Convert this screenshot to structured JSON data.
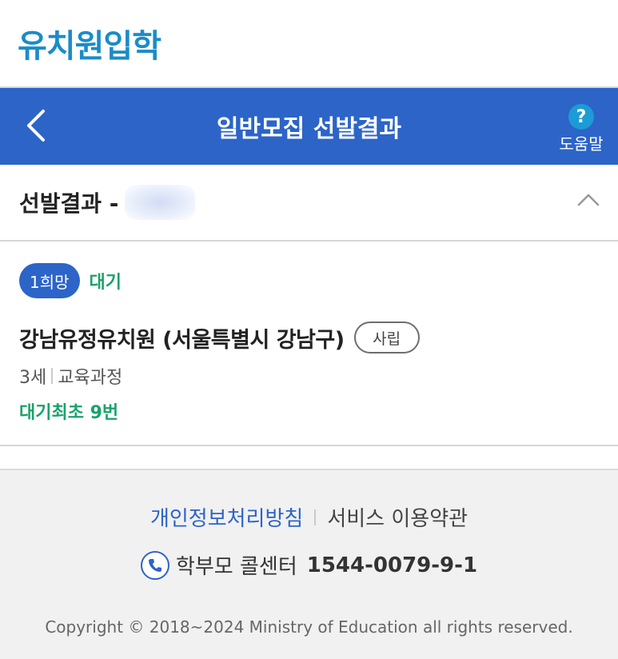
{
  "header": {
    "logo_text": "유치원입학"
  },
  "nav": {
    "title": "일반모집 선발결과",
    "back_icon": "chevron-left-icon",
    "help_icon": "question-icon",
    "help_label": "도움말",
    "bar_color": "#2c64c8"
  },
  "section": {
    "title": "선발결과 -",
    "toggle_icon": "chevron-up-icon"
  },
  "result": {
    "choice_badge": "1희망",
    "status": "대기",
    "school_name": "강남유정유치원 (서울특별시 강남구)",
    "school_type": "사립",
    "age": "3세",
    "course": "교육과정",
    "waitlist": "대기최초 9번",
    "status_color": "#1aa26a"
  },
  "footer": {
    "privacy_link": "개인정보처리방침",
    "terms_link": "서비스 이용약관",
    "call_icon": "phone-icon",
    "call_label": "학부모 콜센터",
    "call_number": "1544-0079-9-1",
    "copyright": "Copyright © 2018~2024 Ministry of Education all rights reserved."
  }
}
